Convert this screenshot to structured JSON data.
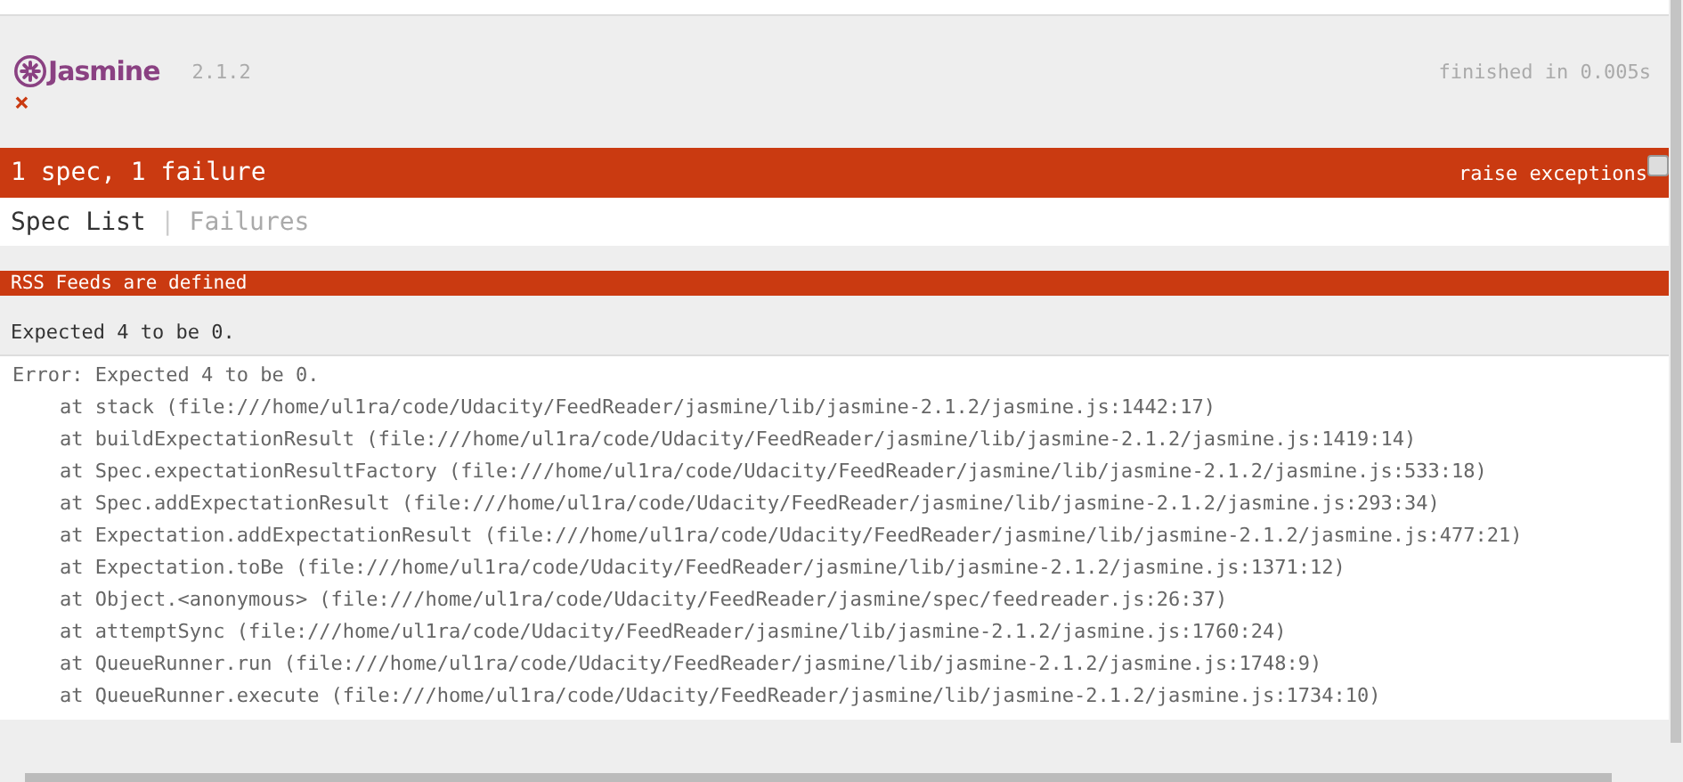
{
  "header": {
    "logo": "Jasmine",
    "version": "2.1.2",
    "duration": "finished in 0.005s",
    "status_symbol": "×"
  },
  "alert": {
    "summary": "1 spec, 1 failure",
    "raise_exceptions": {
      "label": "raise exceptions",
      "checked": false
    }
  },
  "tabs": [
    {
      "label": "Spec List",
      "selected": true
    },
    {
      "label": "Failures",
      "selected": false
    }
  ],
  "tab_separator": "|",
  "failure": {
    "spec": "RSS Feeds are defined",
    "message": "Expected 4 to be 0.",
    "stack": [
      "Error: Expected 4 to be 0.",
      "    at stack (file:///home/ul1ra/code/Udacity/FeedReader/jasmine/lib/jasmine-2.1.2/jasmine.js:1442:17)",
      "    at buildExpectationResult (file:///home/ul1ra/code/Udacity/FeedReader/jasmine/lib/jasmine-2.1.2/jasmine.js:1419:14)",
      "    at Spec.expectationResultFactory (file:///home/ul1ra/code/Udacity/FeedReader/jasmine/lib/jasmine-2.1.2/jasmine.js:533:18)",
      "    at Spec.addExpectationResult (file:///home/ul1ra/code/Udacity/FeedReader/jasmine/lib/jasmine-2.1.2/jasmine.js:293:34)",
      "    at Expectation.addExpectationResult (file:///home/ul1ra/code/Udacity/FeedReader/jasmine/lib/jasmine-2.1.2/jasmine.js:477:21)",
      "    at Expectation.toBe (file:///home/ul1ra/code/Udacity/FeedReader/jasmine/lib/jasmine-2.1.2/jasmine.js:1371:12)",
      "    at Object.<anonymous> (file:///home/ul1ra/code/Udacity/FeedReader/jasmine/spec/feedreader.js:26:37)",
      "    at attemptSync (file:///home/ul1ra/code/Udacity/FeedReader/jasmine/lib/jasmine-2.1.2/jasmine.js:1760:24)",
      "    at QueueRunner.run (file:///home/ul1ra/code/Udacity/FeedReader/jasmine/lib/jasmine-2.1.2/jasmine.js:1748:9)",
      "    at QueueRunner.execute (file:///home/ul1ra/code/Udacity/FeedReader/jasmine/lib/jasmine-2.1.2/jasmine.js:1734:10)"
    ]
  }
}
